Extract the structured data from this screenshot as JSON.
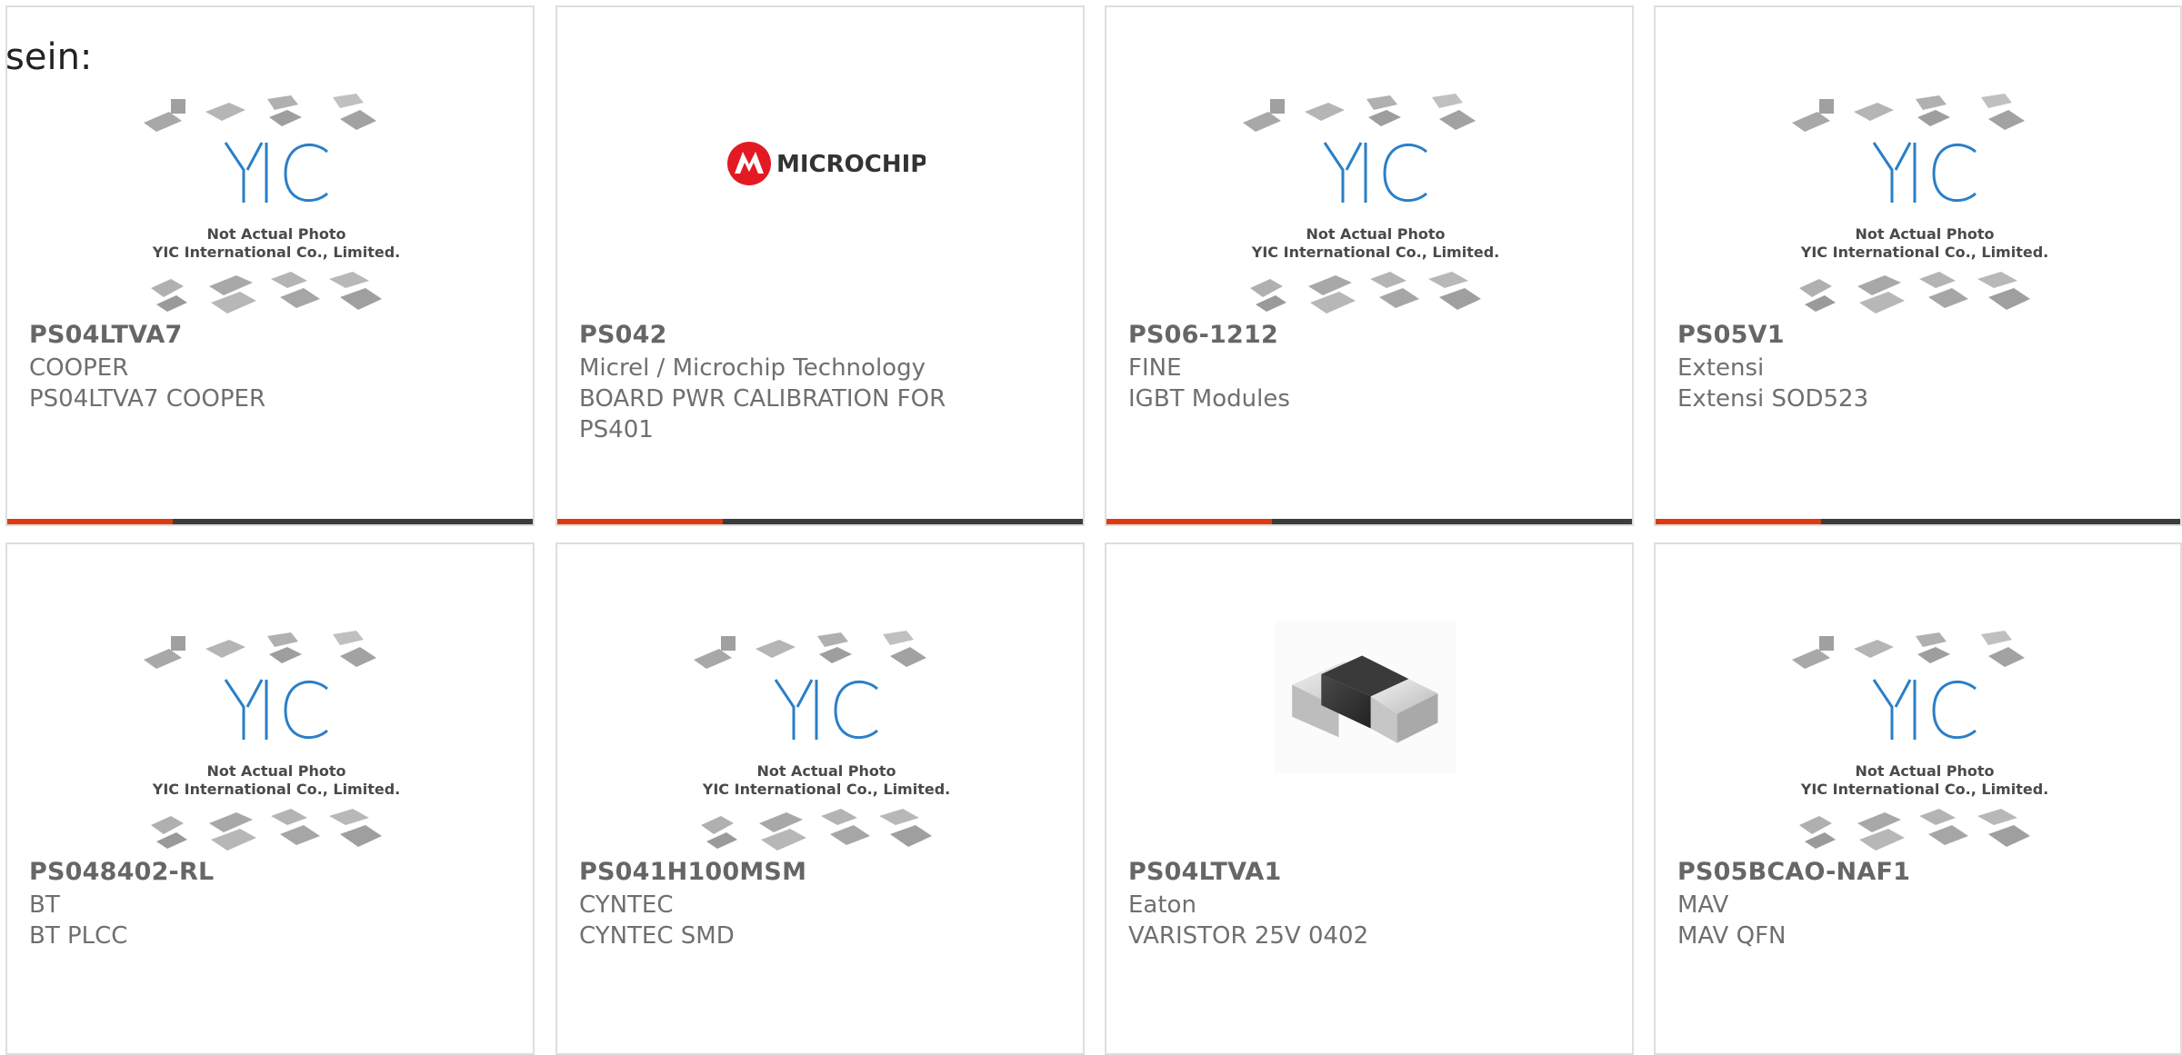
{
  "lead_text": "sein:",
  "colors": {
    "accent": "#dc3b12",
    "bar": "#3c3c3c",
    "yic_blue": "#2a7fc7"
  },
  "placeholder": {
    "line1": "Not Actual Photo",
    "line2": "YIC International Co., Limited.",
    "logo_text": "YIC"
  },
  "microchip_logo_text": "MICROCHIP",
  "products": [
    {
      "part": "PS04LTVA7",
      "manufacturer": "COOPER",
      "desc": "PS04LTVA7 COOPER",
      "image": "placeholder"
    },
    {
      "part": "PS042",
      "manufacturer": "Micrel / Microchip Technology",
      "desc": "BOARD PWR CALIBRATION FOR PS401",
      "image": "microchip-logo"
    },
    {
      "part": "PS06-1212",
      "manufacturer": "FINE",
      "desc": "IGBT Modules",
      "image": "placeholder"
    },
    {
      "part": "PS05V1",
      "manufacturer": "Extensi",
      "desc": "Extensi SOD523",
      "image": "placeholder"
    },
    {
      "part": "PS048402-RL",
      "manufacturer": "BT",
      "desc": "BT PLCC",
      "image": "placeholder"
    },
    {
      "part": "PS041H100MSM",
      "manufacturer": "CYNTEC",
      "desc": "CYNTEC SMD",
      "image": "placeholder"
    },
    {
      "part": "PS04LTVA1",
      "manufacturer": "Eaton",
      "desc": "VARISTOR 25V 0402",
      "image": "chip-component"
    },
    {
      "part": "PS05BCAO-NAF1",
      "manufacturer": "MAV",
      "desc": "MAV QFN",
      "image": "placeholder"
    }
  ]
}
